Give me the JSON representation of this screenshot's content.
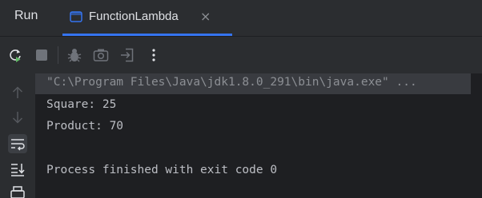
{
  "panel": {
    "title": "Run",
    "tab": {
      "label": "FunctionLambda",
      "close": "×"
    }
  },
  "toolbar": {
    "buttons": [
      {
        "name": "rerun-icon"
      },
      {
        "name": "stop-icon"
      },
      {
        "name": "debug-icon"
      },
      {
        "name": "camera-icon"
      },
      {
        "name": "exit-icon"
      },
      {
        "name": "more-icon"
      }
    ]
  },
  "gutter": {
    "buttons": [
      {
        "name": "arrow-up-icon"
      },
      {
        "name": "arrow-down-icon"
      },
      {
        "name": "soft-wrap-icon",
        "active": true
      },
      {
        "name": "scroll-to-end-icon"
      },
      {
        "name": "print-icon"
      }
    ]
  },
  "console": {
    "command": "\"C:\\Program Files\\Java\\jdk1.8.0_291\\bin\\java.exe\"",
    "folded": "...",
    "lines": [
      "Square: 25",
      "Product: 70",
      "",
      "Process finished with exit code 0"
    ]
  },
  "colors": {
    "background": "#1e1f22",
    "panel": "#2b2d30",
    "accent": "#3574f0",
    "text": "#bcbec4",
    "muted": "#8c8f94",
    "rerun": "#5fb865"
  }
}
